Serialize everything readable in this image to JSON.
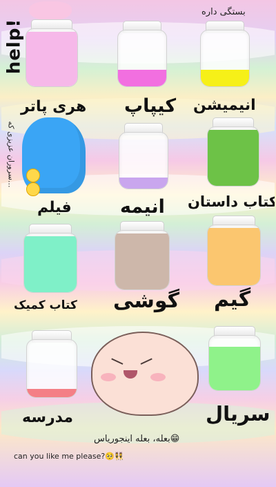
{
  "header": {
    "title": "بستگی داره",
    "help_tag": "help!"
  },
  "side_note": "سروران عزیزی که...",
  "jars": [
    {
      "label": "هری پاتر",
      "fill_color": "#f6b8e9",
      "fill_level": 0.95
    },
    {
      "label": "کیپاپ",
      "fill_color": "#f26fe0",
      "fill_level": 0.3
    },
    {
      "label": "انیمیشن",
      "fill_color": "#f6f018",
      "fill_level": 0.3
    },
    {
      "label": "فیلم",
      "fill_color": "#3aa5f5",
      "fill_level": 0.95
    },
    {
      "label": "انیمه",
      "fill_color": "#c9a6ee",
      "fill_level": 0.2
    },
    {
      "label": "کتاب داستان",
      "fill_color": "#6dc247",
      "fill_level": 0.95
    },
    {
      "label": "کتاب کمیک",
      "fill_color": "#7ff0c8",
      "fill_level": 0.95
    },
    {
      "label": "گوشی",
      "fill_color": "#cdb7aa",
      "fill_level": 0.95
    },
    {
      "label": "گیم",
      "fill_color": "#fbc66f",
      "fill_level": 0.95
    },
    {
      "label": "مدرسه",
      "fill_color": "#f47f86",
      "fill_level": 0.15
    },
    {
      "label": "سریال",
      "fill_color": "#8ff28a",
      "fill_level": 0.8
    }
  ],
  "footer": {
    "caption_fa": "بعله، بعله اینجوریاس😁",
    "caption_en": "can you like me please?🥺👯"
  },
  "icons": [
    "help-bubble-icon",
    "crying-emoji-icon",
    "blushing-blob-icon"
  ]
}
